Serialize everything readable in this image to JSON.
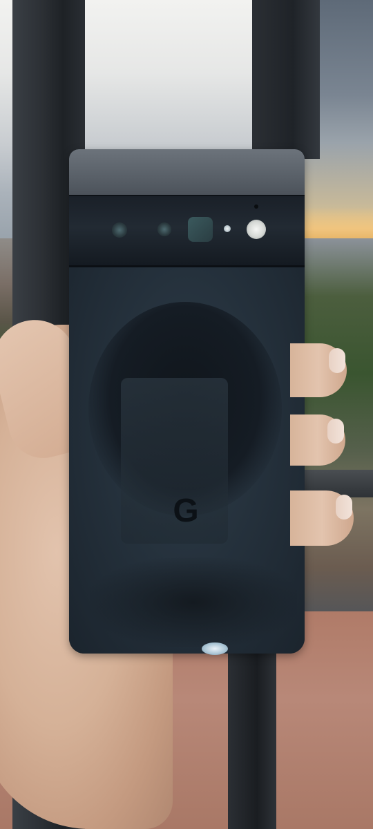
{
  "photo": {
    "subject": "phone-back",
    "logo_text": "G"
  },
  "colors": {
    "phone_body": "#1e2630",
    "camera_bar": "#1a2028",
    "top_band": "#6c737b",
    "skin": "#d5b197",
    "sky": "#e6e7e6",
    "ledge": "#b07b68",
    "railing": "#2c3035"
  }
}
